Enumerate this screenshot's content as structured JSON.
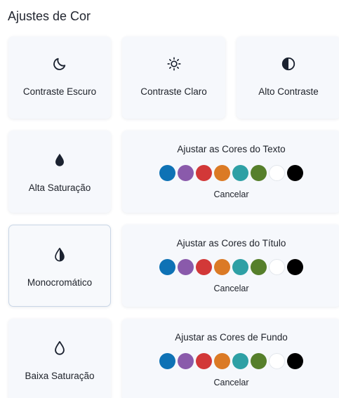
{
  "header": {
    "title": "Ajustes de Cor"
  },
  "contrast": {
    "dark": {
      "label": "Contraste Escuro",
      "icon": "moon-icon"
    },
    "light": {
      "label": "Contraste Claro",
      "icon": "sun-icon"
    },
    "high": {
      "label": "Alto Contraste",
      "icon": "half-circle-icon"
    }
  },
  "saturation": {
    "high": {
      "label": "Alta Saturação",
      "icon": "drop-filled-icon"
    },
    "mono": {
      "label": "Monocromático",
      "icon": "drop-half-icon"
    },
    "low": {
      "label": "Baixa Saturação",
      "icon": "drop-outline-icon"
    }
  },
  "pickers": {
    "text": {
      "title": "Ajustar as Cores do Texto",
      "cancel": "Cancelar"
    },
    "heading": {
      "title": "Ajustar as Cores do Título",
      "cancel": "Cancelar"
    },
    "background": {
      "title": "Ajustar as Cores de Fundo",
      "cancel": "Cancelar"
    }
  },
  "swatch_colors": [
    "#0e72b5",
    "#8a5aab",
    "#d23838",
    "#db7a25",
    "#2ea0a5",
    "#567f2b",
    "#ffffff",
    "#000000"
  ]
}
